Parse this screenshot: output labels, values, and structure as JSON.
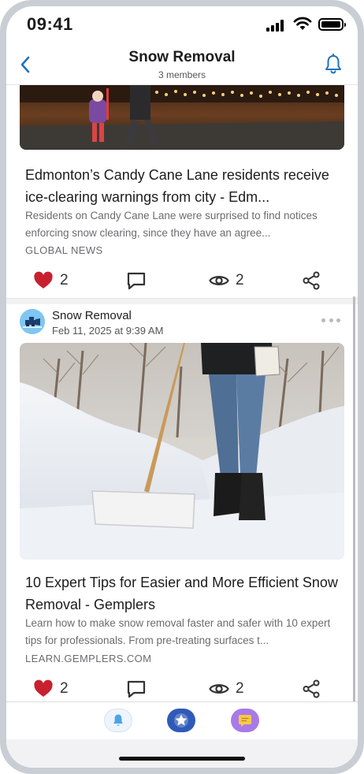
{
  "status_bar": {
    "time": "09:41"
  },
  "header": {
    "title": "Snow Removal",
    "subtitle": "3 members"
  },
  "posts": [
    {
      "headline": "Edmonton’s Candy Cane Lane residents receive ice-clearing warnings from city - Edm...",
      "summary": "Residents on Candy Cane Lane were surprised to find notices enforcing snow clearing, since they have an agree...",
      "source": "GLOBAL NEWS",
      "likes": "2",
      "views": "2"
    },
    {
      "author": "Snow Removal",
      "date": "Feb 11, 2025 at 9:39 AM",
      "headline": "10 Expert Tips for Easier and More Efficient Snow Removal - Gemplers",
      "summary": "Learn how to make snow removal faster and safer with 10 expert tips for professionals. From pre-treating surfaces t...",
      "source": "LEARN.GEMPLERS.COM",
      "likes": "2",
      "views": "2"
    }
  ],
  "colors": {
    "accent": "#1e73be",
    "heart": "#c8202f",
    "favorites_tab": "#2f5ab8",
    "chat_tab": "#a97ae6",
    "text_secondary": "#6c6c70"
  },
  "icons": {
    "back": "chevron-left-icon",
    "notifications": "bell-icon",
    "like": "heart-icon",
    "comment": "comment-icon",
    "views": "eye-icon",
    "share": "share-icon",
    "more": "more-icon",
    "tabs": [
      "bell-icon",
      "star-icon",
      "chat-icon"
    ]
  }
}
